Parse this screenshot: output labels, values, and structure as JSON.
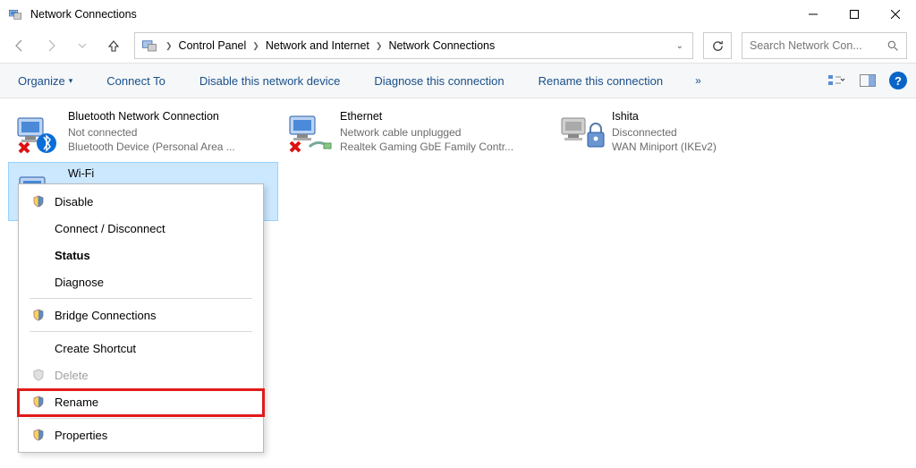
{
  "window": {
    "title": "Network Connections"
  },
  "breadcrumbs": {
    "items": [
      "Control Panel",
      "Network and Internet",
      "Network Connections"
    ]
  },
  "search": {
    "placeholder": "Search Network Con..."
  },
  "toolbar": {
    "organize": "Organize",
    "connect": "Connect To",
    "disable": "Disable this network device",
    "diagnose": "Diagnose this connection",
    "rename": "Rename this connection",
    "more": "»"
  },
  "connections": [
    {
      "name": "Bluetooth Network Connection",
      "status": "Not connected",
      "device": "Bluetooth Device (Personal Area ...",
      "icon": "bluetooth",
      "error": true
    },
    {
      "name": "Ethernet",
      "status": "Network cable unplugged",
      "device": "Realtek Gaming GbE Family Contr...",
      "icon": "ethernet",
      "error": true
    },
    {
      "name": "Ishita",
      "status": "Disconnected",
      "device": "WAN Miniport (IKEv2)",
      "icon": "vpn",
      "error": false
    },
    {
      "name": "Wi-Fi",
      "status": "",
      "device": "",
      "icon": "wifi",
      "selected": true
    }
  ],
  "context_menu": {
    "disable": "Disable",
    "connect": "Connect / Disconnect",
    "status": "Status",
    "diagnose": "Diagnose",
    "bridge": "Bridge Connections",
    "shortcut": "Create Shortcut",
    "delete": "Delete",
    "rename": "Rename",
    "properties": "Properties"
  }
}
